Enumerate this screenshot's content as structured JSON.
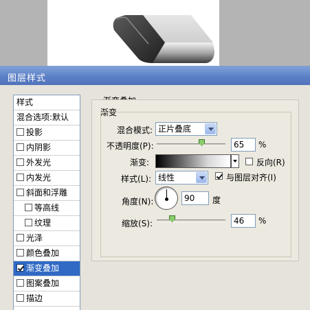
{
  "canvas": {
    "shape_colors": {
      "dark": "#3b3b3b",
      "light": "#d9d9d9"
    }
  },
  "dialog": {
    "title": "图层样式"
  },
  "style_list": {
    "header": "样式",
    "blend_options": "混合选项:默认",
    "items": [
      {
        "label": "投影",
        "checked": false,
        "indent": false,
        "selected": false
      },
      {
        "label": "内阴影",
        "checked": false,
        "indent": false,
        "selected": false
      },
      {
        "label": "外发光",
        "checked": false,
        "indent": false,
        "selected": false
      },
      {
        "label": "内发光",
        "checked": false,
        "indent": false,
        "selected": false
      },
      {
        "label": "斜面和浮雕",
        "checked": false,
        "indent": false,
        "selected": false
      },
      {
        "label": "等高线",
        "checked": false,
        "indent": true,
        "selected": false
      },
      {
        "label": "纹理",
        "checked": false,
        "indent": true,
        "selected": false
      },
      {
        "label": "光泽",
        "checked": false,
        "indent": false,
        "selected": false
      },
      {
        "label": "颜色叠加",
        "checked": false,
        "indent": false,
        "selected": false
      },
      {
        "label": "渐变叠加",
        "checked": true,
        "indent": false,
        "selected": true
      },
      {
        "label": "图案叠加",
        "checked": false,
        "indent": false,
        "selected": false
      },
      {
        "label": "描边",
        "checked": false,
        "indent": false,
        "selected": false
      }
    ]
  },
  "panel": {
    "group_title": "渐变叠加",
    "sub_title": "渐变",
    "blend_mode_label": "混合模式:",
    "blend_mode_value": "正片叠底",
    "opacity_label": "不透明度(P):",
    "opacity_value": "65",
    "opacity_fraction": 0.65,
    "percent": "%",
    "gradient_label": "渐变:",
    "reverse_label": "反向(R)",
    "reverse_checked": false,
    "style_label": "样式(L):",
    "style_value": "线性",
    "align_label": "与图层对齐(I)",
    "align_checked": true,
    "angle_label": "角度(N):",
    "angle_value": "90",
    "angle_unit": "度",
    "scale_label": "缩放(S):",
    "scale_value": "46",
    "scale_fraction": 0.46,
    "scale_percent": "%"
  }
}
